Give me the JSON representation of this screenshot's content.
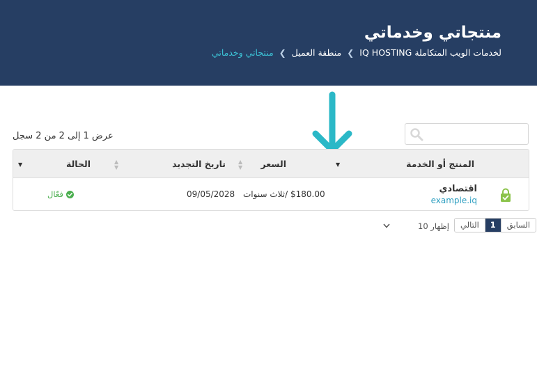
{
  "header": {
    "title": "منتجاتي وخدماتي",
    "breadcrumb": [
      {
        "label": "IQ HOSTING لخدمات الويب المتكاملة"
      },
      {
        "label": "منطقة العميل"
      },
      {
        "label": "منتجاتي وخدماتي"
      }
    ]
  },
  "table_info": {
    "summary": "عرض 1 إلى 2 من 2 سجل"
  },
  "search": {
    "placeholder": ""
  },
  "table": {
    "columns": {
      "product": "المنتج أو الخدمة",
      "price": "السعر",
      "renewal": "تاريخ التجديد",
      "status": "الحالة"
    },
    "rows": [
      {
        "product": "اقتصادي",
        "domain": "example.iq",
        "price": "$180.00 /ثلاث سنوات",
        "renewal": "09/05/2028",
        "status": "فعّال"
      }
    ]
  },
  "pagination": {
    "prev": "السابق",
    "page": "1",
    "next": "التالي"
  },
  "length": {
    "label": "إظهار",
    "value": "10"
  },
  "colors": {
    "header_bg": "#263e63",
    "accent": "#3cc3d6",
    "active": "#4caf50"
  }
}
